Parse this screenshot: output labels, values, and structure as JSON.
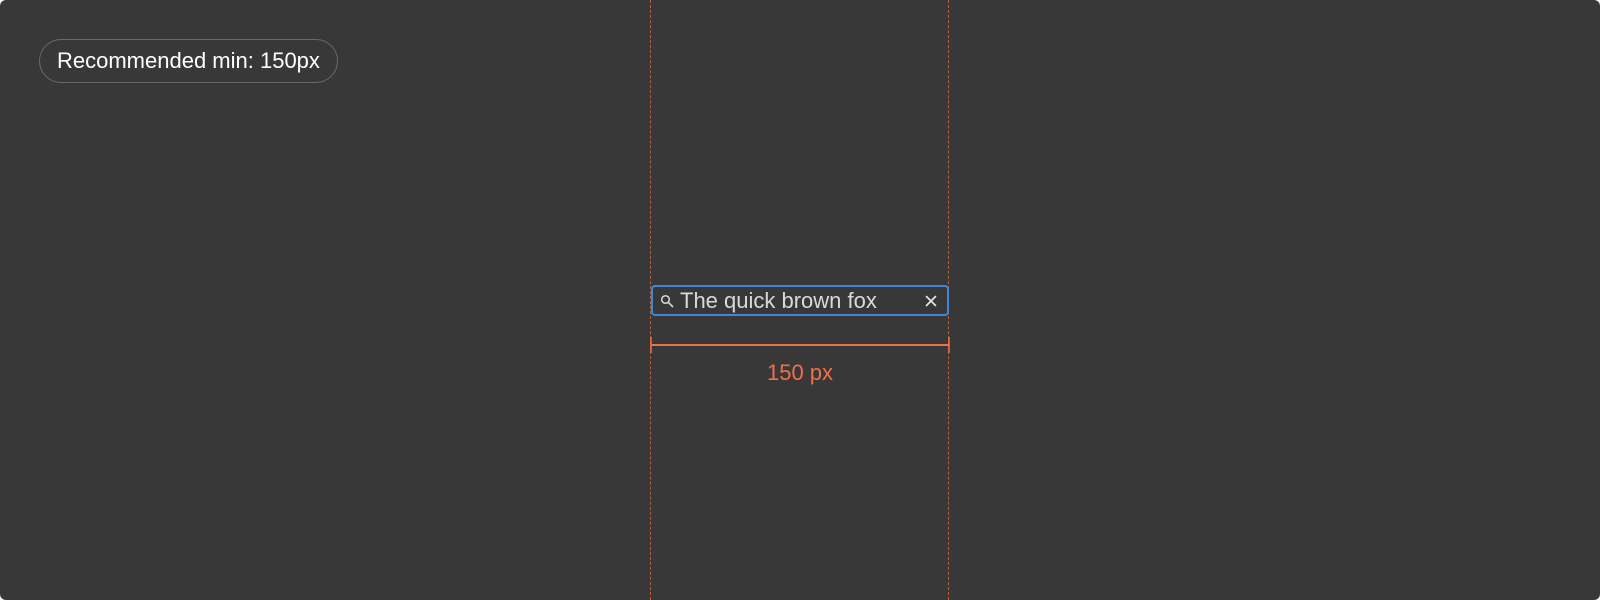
{
  "badge": {
    "label": "Recommended min: 150px"
  },
  "search": {
    "value": "The quick brown fox",
    "icon": "search-icon",
    "clear_icon": "close-icon"
  },
  "measurement": {
    "label": "150 px"
  },
  "colors": {
    "background": "#383838",
    "accent_orange": "#f07046",
    "focus_blue": "#3d87d8",
    "guide_line": "#b55f3f",
    "badge_border": "#6a6a6a",
    "text_primary": "#ffffff",
    "text_input": "#d9d9d9"
  }
}
